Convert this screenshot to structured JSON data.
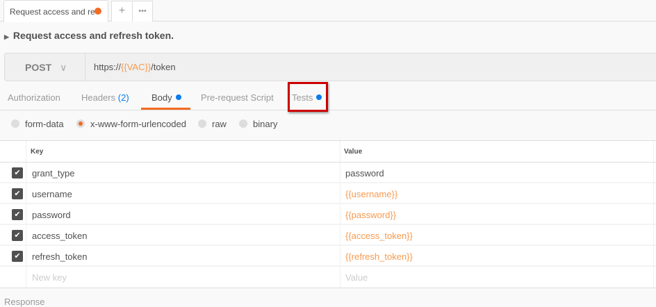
{
  "tab": {
    "label": "Request access and re",
    "unsaved_color": "#f26b21",
    "new_tab": "+",
    "more": "•••"
  },
  "request": {
    "title": "Request access and refresh token.",
    "method": "POST",
    "method_chevron": "∨",
    "url_prefix": "https://",
    "url_var": "{{VAC}}",
    "url_suffix": "/token"
  },
  "tabs": [
    {
      "label": "Authorization"
    },
    {
      "label": "Headers",
      "count": "(2)"
    },
    {
      "label": "Body",
      "active": true,
      "dot": true
    },
    {
      "label": "Pre-request Script"
    },
    {
      "label": "Tests",
      "dot": true,
      "highlighted": true
    }
  ],
  "body_types": [
    {
      "label": "form-data"
    },
    {
      "label": "x-www-form-urlencoded",
      "selected": true
    },
    {
      "label": "raw"
    },
    {
      "label": "binary"
    }
  ],
  "table": {
    "columns": [
      "Key",
      "Value"
    ],
    "rows": [
      {
        "key": "grant_type",
        "value": "password",
        "checked": true,
        "is_var": false
      },
      {
        "key": "username",
        "value": "{{username}}",
        "checked": true,
        "is_var": true
      },
      {
        "key": "password",
        "value": "{{password}}",
        "checked": true,
        "is_var": true
      },
      {
        "key": "access_token",
        "value": "{{access_token}}",
        "checked": true,
        "is_var": true
      },
      {
        "key": "refresh_token",
        "value": "{{refresh_token}}",
        "checked": true,
        "is_var": true
      }
    ],
    "new_key_placeholder": "New key",
    "new_value_placeholder": "Value"
  },
  "response_label": "Response",
  "colors": {
    "accent": "#f26b21",
    "variable": "#f79a4f",
    "dot": "#097bed",
    "highlight": "#cc0000"
  }
}
